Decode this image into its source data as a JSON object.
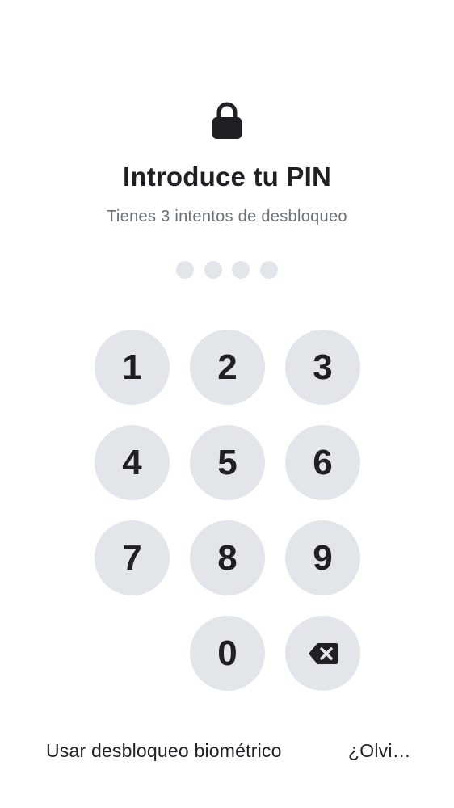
{
  "header": {
    "icon": "lock-icon",
    "title": "Introduce tu PIN",
    "subtitle": "Tienes 3 intentos de desbloqueo"
  },
  "pin": {
    "length": 4,
    "filled": 0
  },
  "keypad": {
    "keys": [
      "1",
      "2",
      "3",
      "4",
      "5",
      "6",
      "7",
      "8",
      "9",
      "0"
    ],
    "backspace_icon": "backspace-icon"
  },
  "footer": {
    "biometric_label": "Usar desbloqueo biométrico",
    "forgot_label": "¿Olvi…"
  },
  "colors": {
    "key_background": "#e2e5ea",
    "text_primary": "#1f2023",
    "text_secondary": "#6b7076"
  }
}
